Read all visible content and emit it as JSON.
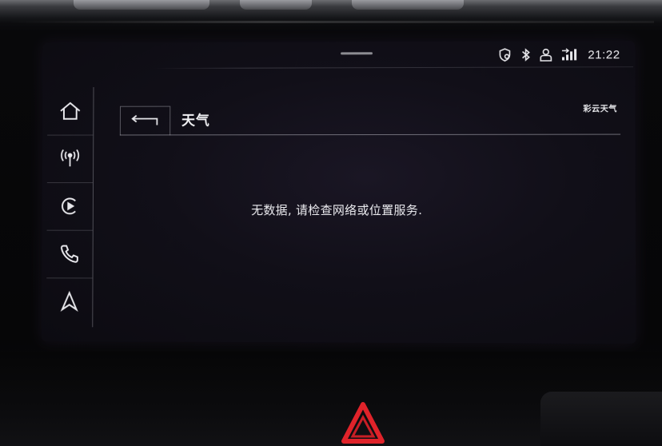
{
  "status_bar": {
    "time": "21:22",
    "icons": [
      "shield-user-icon",
      "bluetooth-icon",
      "profile-icon",
      "signal-icon"
    ]
  },
  "sidebar": {
    "items": [
      {
        "id": "home",
        "icon": "home-icon"
      },
      {
        "id": "radio",
        "icon": "radio-antenna-icon"
      },
      {
        "id": "media",
        "icon": "media-icon"
      },
      {
        "id": "phone",
        "icon": "phone-icon"
      },
      {
        "id": "navigation",
        "icon": "navigation-arrow-icon"
      }
    ]
  },
  "header": {
    "title": "天气",
    "provider": "彩云天气",
    "back_icon": "back-arrow-icon"
  },
  "main": {
    "message": "无数据, 请检查网络或位置服务."
  },
  "colors": {
    "screen_bg": "#110f18",
    "text": "#f2f2f5",
    "hazard": "#e0232a"
  }
}
